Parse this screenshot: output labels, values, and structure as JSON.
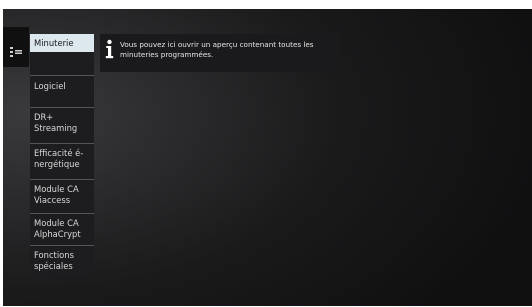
{
  "menu": {
    "items": [
      {
        "label": "Minuterie",
        "selected": true
      },
      {
        "label": "Logiciel",
        "selected": false
      },
      {
        "label": "DR+ Streaming",
        "selected": false
      },
      {
        "label": "Efficacité é-nergétique",
        "selected": false
      },
      {
        "label": "Module CA Viaccess",
        "selected": false
      },
      {
        "label": "Module CA AlphaCrypt",
        "selected": false
      },
      {
        "label": "Fonctions spéciales",
        "selected": false
      }
    ]
  },
  "info": {
    "icon": "info-icon",
    "text": "Vous pouvez ici ouvrir un aperçu contenant toutes les minuteries programmées."
  },
  "colors": {
    "selected_bg": "#dce7ee",
    "menu_bg": "#1d1d1f",
    "background": "#2a2a2c"
  }
}
